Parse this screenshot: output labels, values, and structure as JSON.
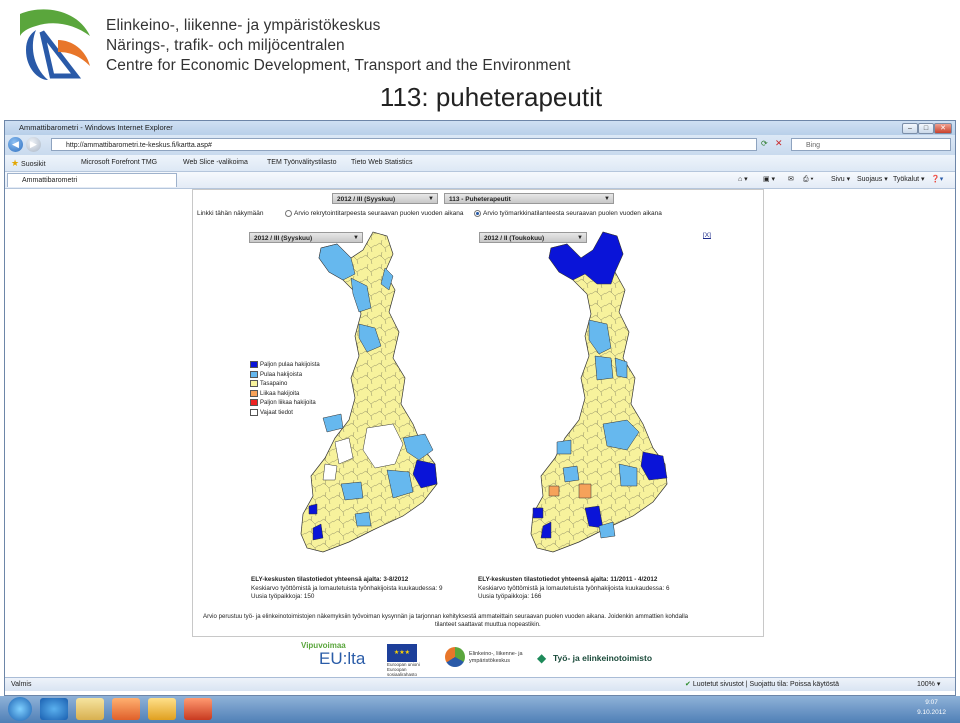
{
  "header": {
    "org_fi": "Elinkeino-, liikenne- ja ympäristökeskus",
    "org_sv": "Närings-, trafik- och miljöcentralen",
    "org_en": "Centre for Economic Development, Transport and the Environment",
    "slide_title": "113: puheterapeutit"
  },
  "browser": {
    "window_title": "Ammattibarometri - Windows Internet Explorer",
    "url": "http://ammattibarometri.te-keskus.fi/kartta.asp#",
    "search_placeholder": "Bing",
    "favorites_label": "Suosikit",
    "favorites": [
      "Microsoft Forefront TMG",
      "Web Slice -valikoima",
      "TEM Työnvälitystilasto",
      "Tieto Web Statistics"
    ],
    "tab_label": "Ammattibarometri",
    "commands": [
      "Sivu",
      "Suojaus",
      "Työkalut"
    ],
    "status_left": "Valmis",
    "status_right": "Luotetut sivustot | Suojattu tila: Poissa käytöstä",
    "zoom": "100%"
  },
  "page": {
    "period_select": "2012 / III (Syyskuu)",
    "profession_select": "113 - Puheterapeutit",
    "link_label": "Linkki tähän näkymään",
    "radio_1": "Arvio rekrytointitarpeesta seuraavan puolen vuoden aikana",
    "radio_2": "Arvio työmarkkinatilanteesta seuraavan puolen vuoden aikana",
    "map_left_select": "2012 / III (Syyskuu)",
    "map_right_select": "2012 / II (Toukokuu)",
    "close_label": "[X]",
    "legend": [
      {
        "label": "Paljon pulaa hakijoista",
        "color": "#0a14d8"
      },
      {
        "label": "Pulaa hakijoista",
        "color": "#66b8ee"
      },
      {
        "label": "Tasapaino",
        "color": "#f7f29c"
      },
      {
        "label": "Liikaa hakijoita",
        "color": "#f6a25a"
      },
      {
        "label": "Paljon liikaa hakijoita",
        "color": "#ee2222"
      },
      {
        "label": "Vajaat tiedot",
        "color": "#ffffff"
      }
    ],
    "left_stats": {
      "title": "ELY-keskusten tilastotiedot yhteensä ajalta: 3-8/2012",
      "line1": "Keskiarvo työttömistä ja lomautetuista työnhakijoista kuukaudessa: 9",
      "line2": "Uusia työpaikkoja: 150"
    },
    "right_stats": {
      "title": "ELY-keskusten tilastotiedot yhteensä ajalta: 11/2011 - 4/2012",
      "line1": "Keskiarvo työttömistä ja lomautetuista työnhakijoista kuukaudessa: 6",
      "line2": "Uusia työpaikkoja: 166"
    },
    "note_1": "Arvio perustuu työ- ja elinkeinotoimistojen näkemyksiin työvoiman kysynnän ja tarjonnan kehityksestä ammateittain seuraavan puolen vuoden aikana. Joidenkin ammattien kohdalla",
    "note_2": "tilanteet saattavat muuttua nopeastikin.",
    "footer_logo_1": "Vipuvoimaa",
    "footer_logo_2": "EU:lta",
    "footer_logo_3": "Euroopan unioni Euroopan sosiaalirahasto",
    "footer_logo_4": "Elinkeino-, liikenne- ja ympäristökeskus",
    "footer_logo_5": "Työ- ja elinkeinotoimisto"
  },
  "taskbar": {
    "time": "9:07",
    "date": "9.10.2012"
  }
}
